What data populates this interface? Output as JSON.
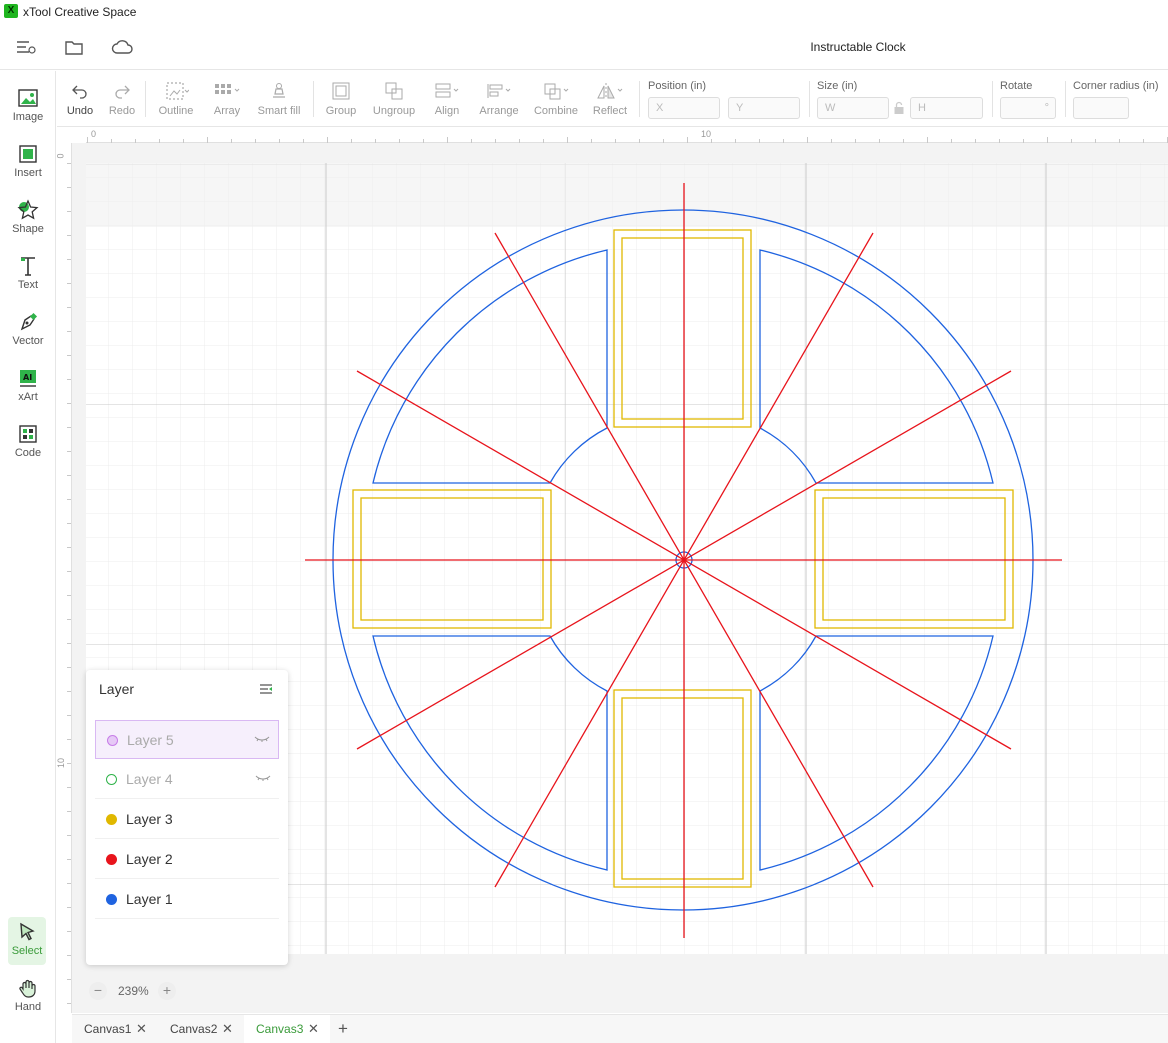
{
  "app": {
    "title": "xTool Creative Space",
    "logo_text": "X"
  },
  "document": {
    "title": "Instructable Clock"
  },
  "topbar": {
    "icons": [
      "menu-icon",
      "folder-icon",
      "cloud-icon"
    ]
  },
  "left_tools": [
    {
      "name": "image",
      "label": "Image"
    },
    {
      "name": "insert",
      "label": "Insert"
    },
    {
      "name": "shape",
      "label": "Shape"
    },
    {
      "name": "text",
      "label": "Text"
    },
    {
      "name": "vector",
      "label": "Vector"
    },
    {
      "name": "xart",
      "label": "xArt"
    },
    {
      "name": "code",
      "label": "Code"
    }
  ],
  "bottom_tools": [
    {
      "name": "select",
      "label": "Select"
    },
    {
      "name": "hand",
      "label": "Hand"
    }
  ],
  "toolbar": {
    "undo": "Undo",
    "redo": "Redo",
    "outline": "Outline",
    "array": "Array",
    "smart_fill": "Smart fill",
    "group": "Group",
    "ungroup": "Ungroup",
    "align": "Align",
    "arrange": "Arrange",
    "combine": "Combine",
    "reflect": "Reflect",
    "position_label": "Position (in)",
    "x_placeholder": "X",
    "y_placeholder": "Y",
    "size_label": "Size (in)",
    "w_placeholder": "W",
    "h_placeholder": "H",
    "rotate_label": "Rotate",
    "rotate_unit": "°",
    "corner_label": "Corner radius (in)"
  },
  "rulers": {
    "top_labels": [
      "0",
      "10"
    ],
    "left_labels": [
      "0",
      "10"
    ]
  },
  "layer_panel": {
    "title": "Layer",
    "layers": [
      {
        "name": "Layer 5",
        "color": "#c77ce8",
        "style": "ring",
        "selected": true,
        "hidden": true
      },
      {
        "name": "Layer 4",
        "color": "#2fb34a",
        "style": "ring",
        "selected": false,
        "hidden": true
      },
      {
        "name": "Layer 3",
        "color": "#e0b800",
        "style": "dot",
        "selected": false,
        "hidden": false
      },
      {
        "name": "Layer 2",
        "color": "#e8141c",
        "style": "dot",
        "selected": false,
        "hidden": false
      },
      {
        "name": "Layer 1",
        "color": "#1f63e0",
        "style": "dot",
        "selected": false,
        "hidden": false
      }
    ]
  },
  "zoom": {
    "level": "239%",
    "minus": "−",
    "plus": "+"
  },
  "tabs": [
    {
      "label": "Canvas1",
      "active": false
    },
    {
      "label": "Canvas2",
      "active": false
    },
    {
      "label": "Canvas3",
      "active": true
    }
  ],
  "tab_add": "+",
  "colors": {
    "blue": "#1f63e0",
    "red": "#e8141c",
    "yellow": "#e0b800",
    "accent": "#3a9b3a"
  }
}
